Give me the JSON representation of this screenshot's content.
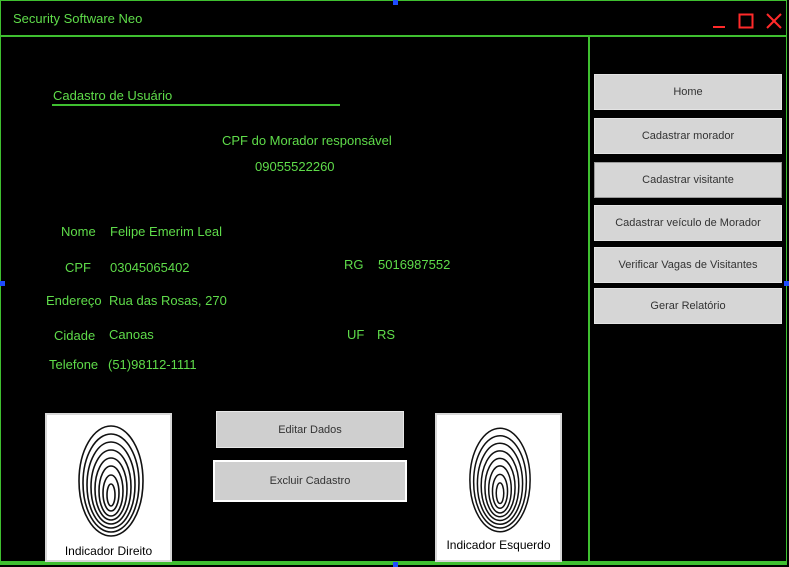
{
  "window": {
    "title": "Security Software Neo"
  },
  "form": {
    "section_title": "Cadastro de Usuário",
    "cpf_responsavel_label": "CPF do Morador responsável",
    "cpf_responsavel_value": "09055522260",
    "fields": {
      "nome_label": "Nome",
      "nome_value": "Felipe Emerim Leal",
      "cpf_label": "CPF",
      "cpf_value": "03045065402",
      "rg_label": "RG",
      "rg_value": "5016987552",
      "endereco_label": "Endereço",
      "endereco_value": "Rua das Rosas, 270",
      "cidade_label": "Cidade",
      "cidade_value": "Canoas",
      "uf_label": "UF",
      "uf_value": "RS",
      "telefone_label": "Telefone",
      "telefone_value": "(51)98112-1111"
    },
    "fingerprints": {
      "right_caption": "Indicador Direito",
      "left_caption": "Indicador Esquerdo"
    },
    "buttons": {
      "edit_label": "Editar Dados",
      "delete_label": "Excluir Cadastro"
    }
  },
  "sidebar": {
    "items": [
      {
        "label": "Home"
      },
      {
        "label": "Cadastrar morador"
      },
      {
        "label": "Cadastrar visitante"
      },
      {
        "label": "Cadastrar veículo de Morador"
      },
      {
        "label": "Verificar Vagas de Visitantes"
      },
      {
        "label": "Gerar Relatório"
      }
    ]
  },
  "colors": {
    "accent": "#3fbf30",
    "text_green": "#5fdc4a",
    "close_red": "#ff2a2a",
    "background": "#000000"
  },
  "icons": [
    "minimize-icon",
    "maximize-icon",
    "close-icon",
    "fingerprint-icon"
  ]
}
